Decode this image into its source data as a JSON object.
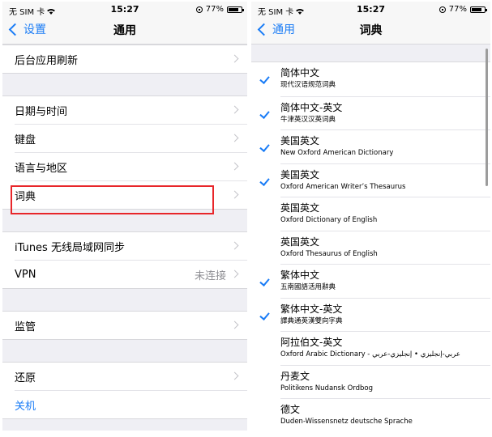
{
  "left": {
    "status": {
      "carrier": "无 SIM 卡",
      "time": "15:27",
      "battery_percent": "77%",
      "battery_level": 0.77
    },
    "nav": {
      "back_label": "设置",
      "title": "通用"
    },
    "groups": [
      [
        {
          "label": "后台应用刷新"
        }
      ],
      [
        {
          "label": "日期与时间"
        },
        {
          "label": "键盘"
        },
        {
          "label": "语言与地区"
        },
        {
          "label": "词典"
        }
      ],
      [
        {
          "label": "iTunes 无线局域网同步"
        },
        {
          "label": "VPN",
          "detail": "未连接"
        }
      ],
      [
        {
          "label": "监管"
        }
      ],
      [
        {
          "label": "还原"
        },
        {
          "label": "关机"
        }
      ]
    ]
  },
  "right": {
    "status": {
      "carrier": "无 SIM 卡",
      "time": "15:27",
      "battery_percent": "77%",
      "battery_level": 0.77
    },
    "nav": {
      "back_label": "通用",
      "title": "词典"
    },
    "dictionaries": [
      {
        "language": "简体中文",
        "name": "现代汉语规范词典",
        "checked": true
      },
      {
        "language": "简体中文-英文",
        "name": "牛津英汉汉英词典",
        "checked": true
      },
      {
        "language": "美国英文",
        "name": "New Oxford American Dictionary",
        "checked": true
      },
      {
        "language": "美国英文",
        "name": "Oxford American Writer’s Thesaurus",
        "checked": true
      },
      {
        "language": "英国英文",
        "name": "Oxford Dictionary of English",
        "checked": false
      },
      {
        "language": "英国英文",
        "name": "Oxford Thesaurus of English",
        "checked": false
      },
      {
        "language": "繁体中文",
        "name": "五南國語活用辭典",
        "checked": true
      },
      {
        "language": "繁体中文-英文",
        "name": "譯典通英漢雙向字典",
        "checked": true
      },
      {
        "language": "阿拉伯文-英文",
        "name": "Oxford Arabic Dictionary - عربي-إنجليزي • إنجليزي-عربي",
        "checked": false
      },
      {
        "language": "丹麦文",
        "name": "Politikens Nudansk Ordbog",
        "checked": false
      },
      {
        "language": "德文",
        "name": "Duden-Wissensnetz deutsche Sprache",
        "checked": false
      }
    ]
  },
  "colors": {
    "accent": "#1a7cf6",
    "highlight": "#e8262a",
    "background": "#efeff4"
  }
}
